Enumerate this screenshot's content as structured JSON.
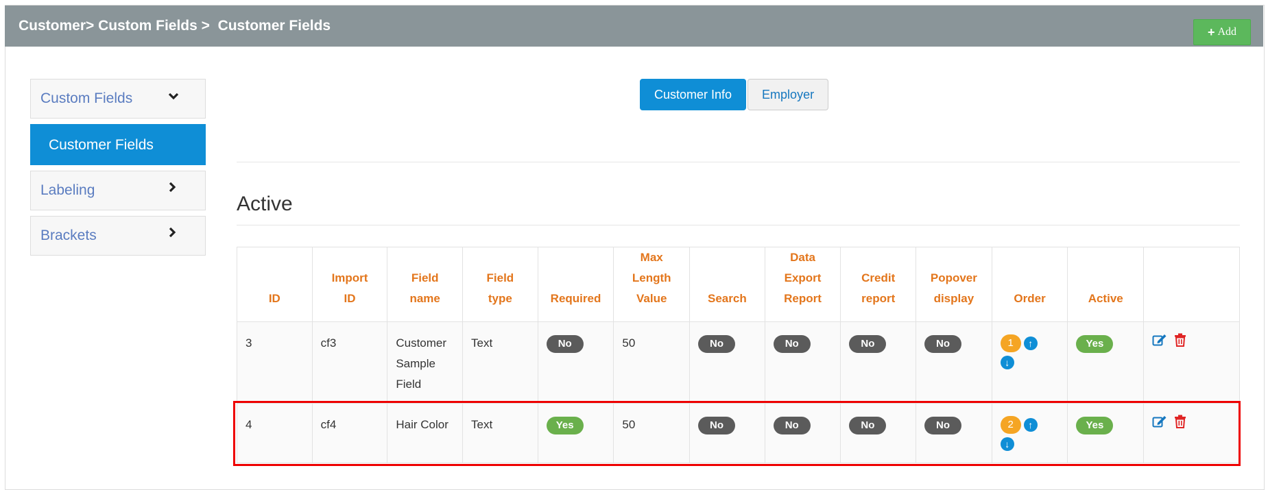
{
  "header": {
    "breadcrumb": "Customer> Custom Fields >  Customer Fields",
    "add_label": "Add"
  },
  "sidebar": {
    "items": [
      {
        "label": "Custom Fields"
      },
      {
        "label": "Customer Fields"
      },
      {
        "label": "Labeling"
      },
      {
        "label": "Brackets"
      }
    ]
  },
  "tabs": [
    {
      "label": "Customer Info"
    },
    {
      "label": "Employer"
    }
  ],
  "section": {
    "title": "Active"
  },
  "table": {
    "headers": [
      "ID",
      "Import\nID",
      "Field\nname",
      "Field\ntype",
      "Required",
      "Max\nLength\nValue",
      "Search",
      "Data\nExport\nReport",
      "Credit\nreport",
      "Popover\ndisplay",
      "Order",
      "Active",
      ""
    ],
    "rows": [
      {
        "id": "3",
        "import_id": "cf3",
        "field_name": "Customer Sample Field",
        "field_type": "Text",
        "required": "No",
        "max_length": "50",
        "search": "No",
        "data_export": "No",
        "credit_report": "No",
        "popover": "No",
        "order": "1",
        "active": "Yes"
      },
      {
        "id": "4",
        "import_id": "cf4",
        "field_name": "Hair Color",
        "field_type": "Text",
        "required": "Yes",
        "max_length": "50",
        "search": "No",
        "data_export": "No",
        "credit_report": "No",
        "popover": "No",
        "order": "2",
        "active": "Yes"
      }
    ]
  },
  "colors": {
    "header_bg": "#8a9599",
    "primary": "#0f8ed6",
    "success": "#5cb85c",
    "th_text": "#e3761c",
    "highlight": "#e00000"
  },
  "icons": {
    "add": "plus-icon",
    "chevron_down": "chevron-down-icon",
    "chevron_right": "chevron-right-icon",
    "up": "arrow-up-circle-icon",
    "down": "arrow-down-circle-icon",
    "edit": "edit-icon",
    "delete": "trash-icon"
  }
}
